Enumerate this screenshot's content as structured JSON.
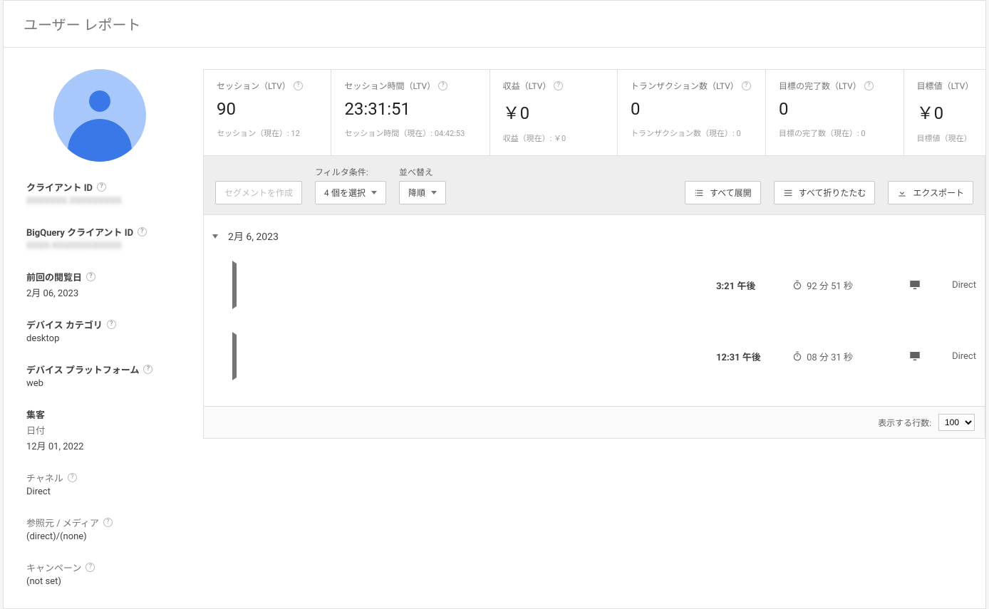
{
  "page_title": "ユーザー レポート",
  "client": {
    "id_label": "クライアント ID",
    "id_value": "XXXXXXX.XXXXXXXXX",
    "bq_label": "BigQuery クライアント ID",
    "bq_value": "XXXX-XXXXXXXXXXXX"
  },
  "details": {
    "last_seen_label": "前回の閲覧日",
    "last_seen_value": "2月 06, 2023",
    "device_cat_label": "デバイス カテゴリ",
    "device_cat_value": "desktop",
    "device_plat_label": "デバイス プラットフォーム",
    "device_plat_value": "web",
    "acq_label": "集客",
    "acq_date_label": "日付",
    "acq_date_value": "12月 01, 2022",
    "channel_label": "チャネル",
    "channel_value": "Direct",
    "source_label": "参照元 / メディア",
    "source_value": "(direct)/(none)",
    "campaign_label": "キャンペーン",
    "campaign_value": "(not set)"
  },
  "metrics": [
    {
      "title": "セッション（LTV）",
      "value": "90",
      "sub": "セッション（現在）: 12"
    },
    {
      "title": "セッション時間（LTV）",
      "value": "23:31:51",
      "sub": "セッション時間（現在）: 04:42:53"
    },
    {
      "title": "収益（LTV）",
      "value": "￥0",
      "sub": "収益（現在）: ￥0"
    },
    {
      "title": "トランザクション数（LTV）",
      "value": "0",
      "sub": "トランザクション数（現在）: 0"
    },
    {
      "title": "目標の完了数（LTV）",
      "value": "0",
      "sub": "目標の完了数（現在）: 0"
    },
    {
      "title": "目標値（LTV）",
      "value": "￥0",
      "sub": "目標値（現在）"
    }
  ],
  "toolbar": {
    "create_segment": "セグメントを作成",
    "filter_label": "フィルタ条件:",
    "filter_value": "4 個を選択",
    "sort_label": "並べ替え",
    "sort_value": "降順",
    "expand_all": "すべて展開",
    "collapse_all": "すべて折りたたむ",
    "export": "エクスポート"
  },
  "day": {
    "label": "2月 6, 2023",
    "sessions": [
      {
        "time": "3:21 午後",
        "duration": "92 分 51 秒",
        "channel": "Direct"
      },
      {
        "time": "12:31 午後",
        "duration": "08 分 31 秒",
        "channel": "Direct"
      }
    ]
  },
  "footer": {
    "rows_label": "表示する行数:",
    "rows_value": "100"
  }
}
